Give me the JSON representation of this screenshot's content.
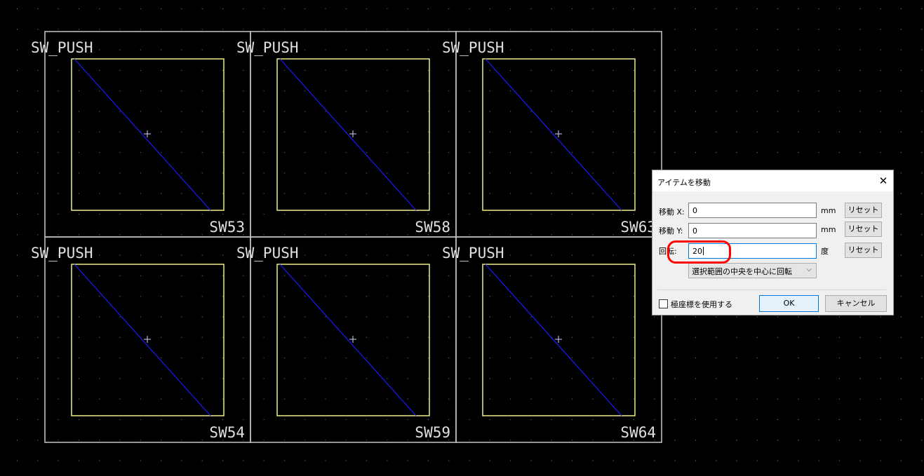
{
  "colors": {
    "background": "#000000",
    "grid_dot": "#8a8a8a",
    "outline": "#c8c8c8",
    "courtyard": "#eeee88",
    "diagonal": "#1a1aff",
    "highlight": "#ff0000"
  },
  "footprints": [
    {
      "value": "SW_PUSH",
      "reference": "SW53"
    },
    {
      "value": "SW_PUSH",
      "reference": "SW58"
    },
    {
      "value": "SW_PUSH",
      "reference": "SW63"
    },
    {
      "value": "SW_PUSH",
      "reference": "SW54"
    },
    {
      "value": "SW_PUSH",
      "reference": "SW59"
    },
    {
      "value": "SW_PUSH",
      "reference": "SW64"
    }
  ],
  "dialog": {
    "title": "アイテムを移動",
    "close_icon": "close-icon",
    "move_x_label": "移動 X:",
    "move_x_value": "0",
    "move_x_unit": "mm",
    "move_y_label": "移動 Y:",
    "move_y_value": "0",
    "move_y_unit": "mm",
    "rotation_label": "回転:",
    "rotation_value": "20",
    "rotation_unit": "度",
    "reset_label": "リセット",
    "rotation_mode": "選択範囲の中央を中心に回転",
    "polar_label": "極座標を使用する",
    "polar_checked": false,
    "ok_label": "OK",
    "cancel_label": "キャンセル"
  }
}
